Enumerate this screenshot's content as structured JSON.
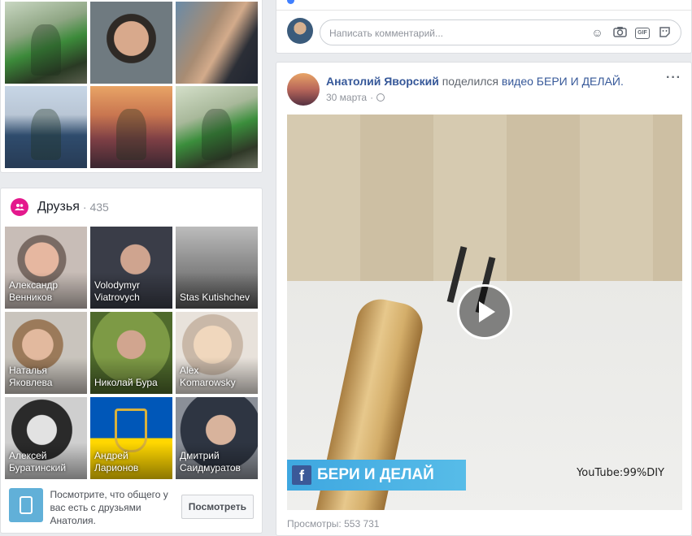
{
  "profile_photos": [
    "photo-1",
    "photo-2",
    "photo-3",
    "photo-4",
    "photo-5",
    "photo-6"
  ],
  "friends": {
    "title": "Друзья",
    "count": "· 435",
    "icon": "friends-icon",
    "list": [
      {
        "name": "Александр Венников"
      },
      {
        "name": "Volodymyr Viatrovych"
      },
      {
        "name": "Stas Kutishchev"
      },
      {
        "name": "Наталья Яковлева"
      },
      {
        "name": "Николай Бура"
      },
      {
        "name": "Alex Komarowsky"
      },
      {
        "name": "Алексей Буратинский"
      },
      {
        "name": "Андрей Ларионов"
      },
      {
        "name": "Дмитрий Саидмуратов"
      }
    ],
    "compare_text": "Посмотрите, что общего у вас есть с друзьями Анатолия.",
    "compare_button": "Посмотреть"
  },
  "comment_box": {
    "placeholder": "Написать комментарий...",
    "icons": [
      "emoji-icon",
      "camera-icon",
      "gif-icon",
      "sticker-icon"
    ]
  },
  "post": {
    "author": "Анатолий Яворский",
    "shared_text": "поделился",
    "video_word": "видео",
    "page_link": "БЕРИ И ДЕЛАЙ",
    "date": "30 марта",
    "more": "···",
    "video": {
      "brand_text": "БЕРИ И ДЕЛАЙ",
      "brand_logo": "f",
      "watermark": "YouTube:99%DIY"
    },
    "views": "Просмотры: 553 731"
  },
  "colors": {
    "link": "#365899",
    "friends_icon_bg": "#e4198d",
    "band": "#3ea7e0",
    "background": "#e9ebee"
  }
}
